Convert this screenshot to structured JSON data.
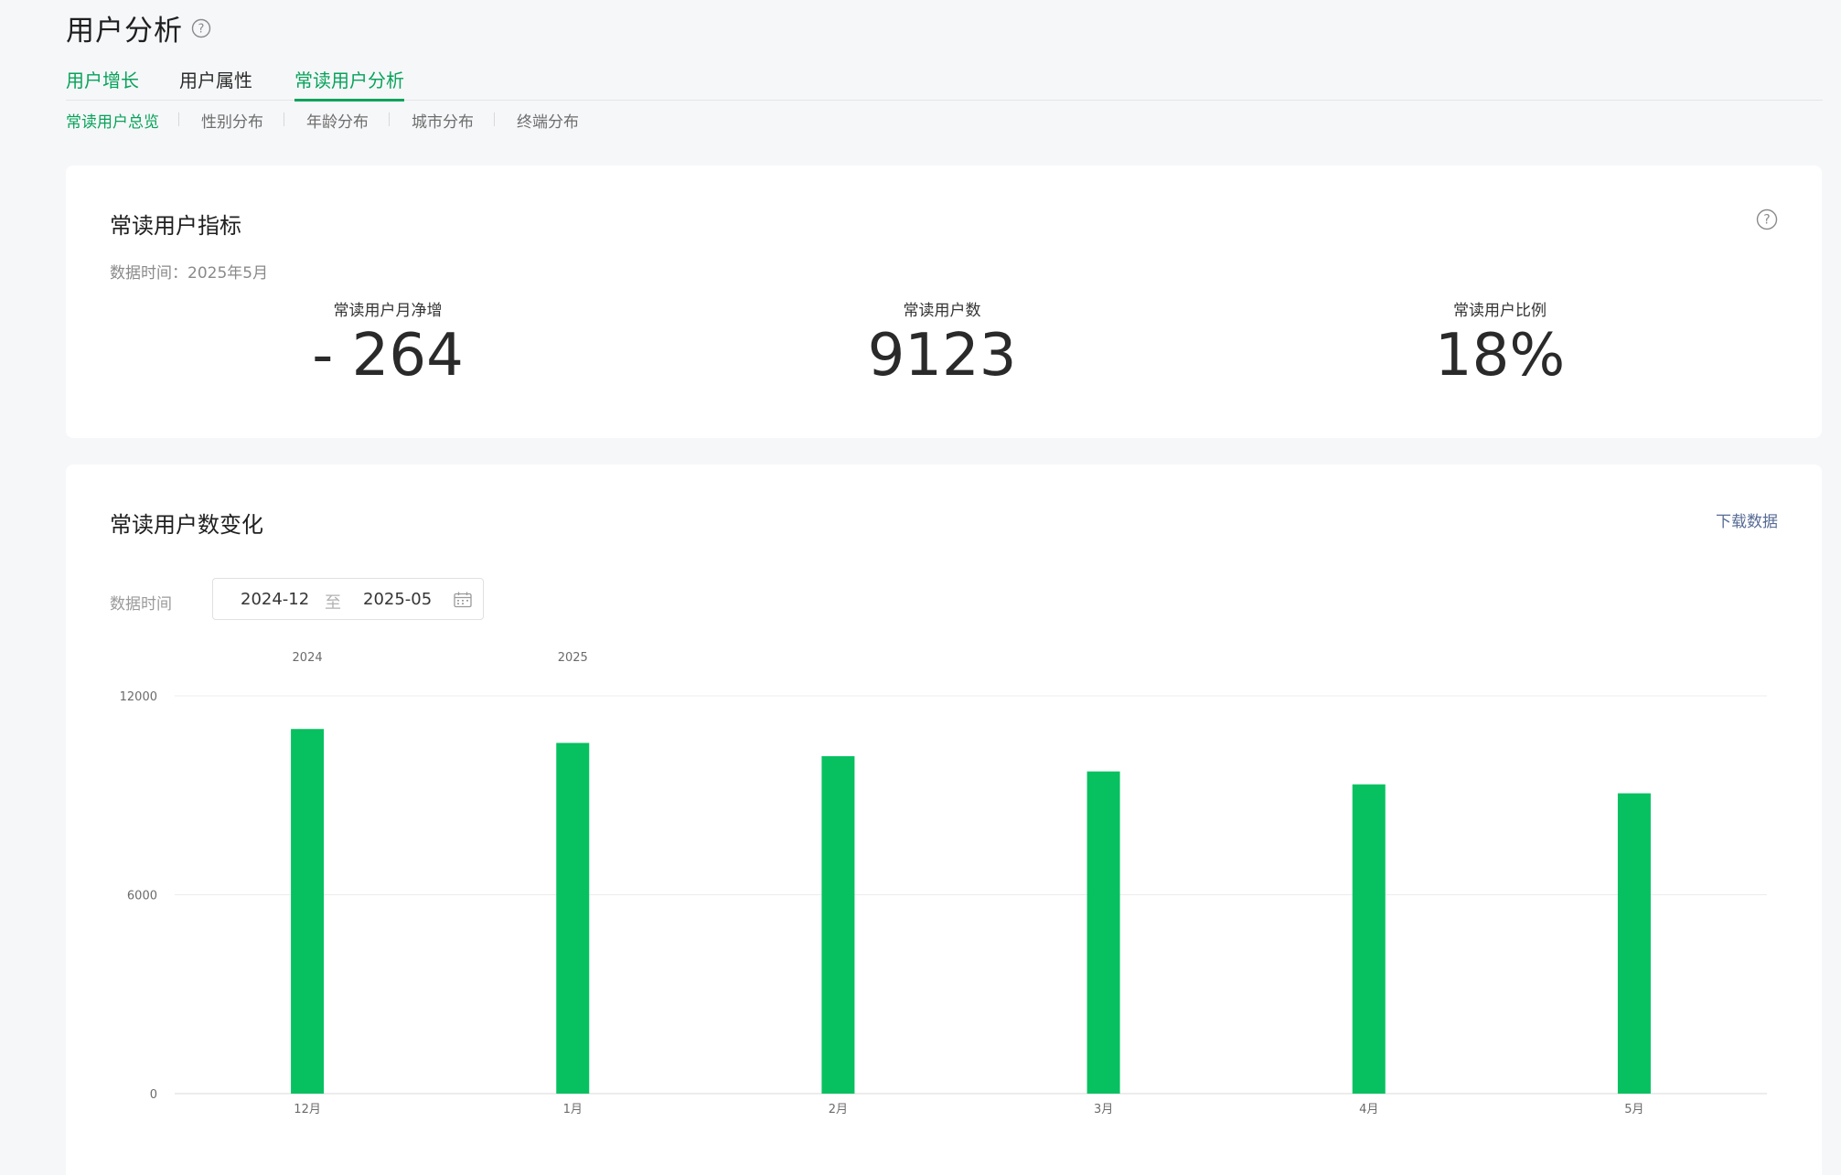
{
  "header": {
    "title": "用户分析",
    "help_icon": "question-circle-icon"
  },
  "tabs": [
    {
      "label": "用户增长",
      "active": true
    },
    {
      "label": "用户属性",
      "active": false
    },
    {
      "label": "常读用户分析",
      "active": true
    }
  ],
  "subtabs": [
    {
      "label": "常读用户总览",
      "active": true
    },
    {
      "label": "性别分布",
      "active": false
    },
    {
      "label": "年龄分布",
      "active": false
    },
    {
      "label": "城市分布",
      "active": false
    },
    {
      "label": "终端分布",
      "active": false
    }
  ],
  "metrics_card": {
    "title": "常读用户指标",
    "data_time": "数据时间：2025年5月",
    "help_icon": "question-circle-icon",
    "metrics": [
      {
        "label": "常读用户月净增",
        "value": "- 264"
      },
      {
        "label": "常读用户数",
        "value": "9123"
      },
      {
        "label": "常读用户比例",
        "value": "18%"
      }
    ]
  },
  "trend_card": {
    "title": "常读用户数变化",
    "download_label": "下载数据",
    "range_label": "数据时间",
    "range_start": "2024-12",
    "range_separator": "至",
    "range_end": "2025-05",
    "calendar_icon": "calendar-icon"
  },
  "colors": {
    "accent": "#07c160",
    "active_tab": "#07a35a",
    "link": "#576b95"
  },
  "chart_data": {
    "type": "bar",
    "categories": [
      "12月",
      "1月",
      "2月",
      "3月",
      "4月",
      "5月"
    ],
    "year_labels": [
      {
        "category": "12月",
        "label": "2024"
      },
      {
        "category": "1月",
        "label": "2025"
      }
    ],
    "series": [
      {
        "values": [
          11000,
          10580,
          10180,
          9720,
          9330,
          9060
        ]
      }
    ],
    "yticks": [
      0,
      6000,
      12000
    ],
    "ylim": [
      0,
      12000
    ],
    "grid": true,
    "bar_color": "#07c160"
  }
}
